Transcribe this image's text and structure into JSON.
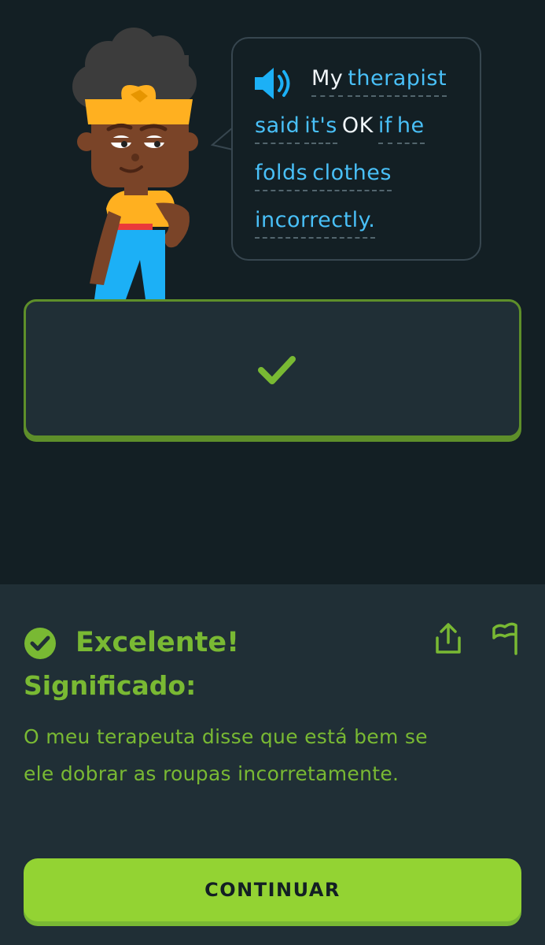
{
  "speech": {
    "line1": [
      "My",
      "therapist"
    ],
    "line2": [
      "said",
      "it's",
      "OK",
      "if",
      "he"
    ],
    "line3": [
      "folds",
      "clothes"
    ],
    "line4": [
      "incorrectly."
    ]
  },
  "feedback": {
    "title": "Excelente!",
    "meaning_label": "Significado:",
    "translation": "O meu terapeuta disse que está bem se ele dobrar as roupas incorretamente.",
    "continue_label": "CONTINUAR"
  },
  "colors": {
    "background": "#131f24",
    "panel": "#202f36",
    "accent_green": "#79b933",
    "button_green": "#93d333",
    "word_blue": "#49c0f8"
  },
  "icons": [
    "speaker-icon",
    "checkmark-icon",
    "check-circle-icon",
    "share-icon",
    "flag-icon"
  ]
}
